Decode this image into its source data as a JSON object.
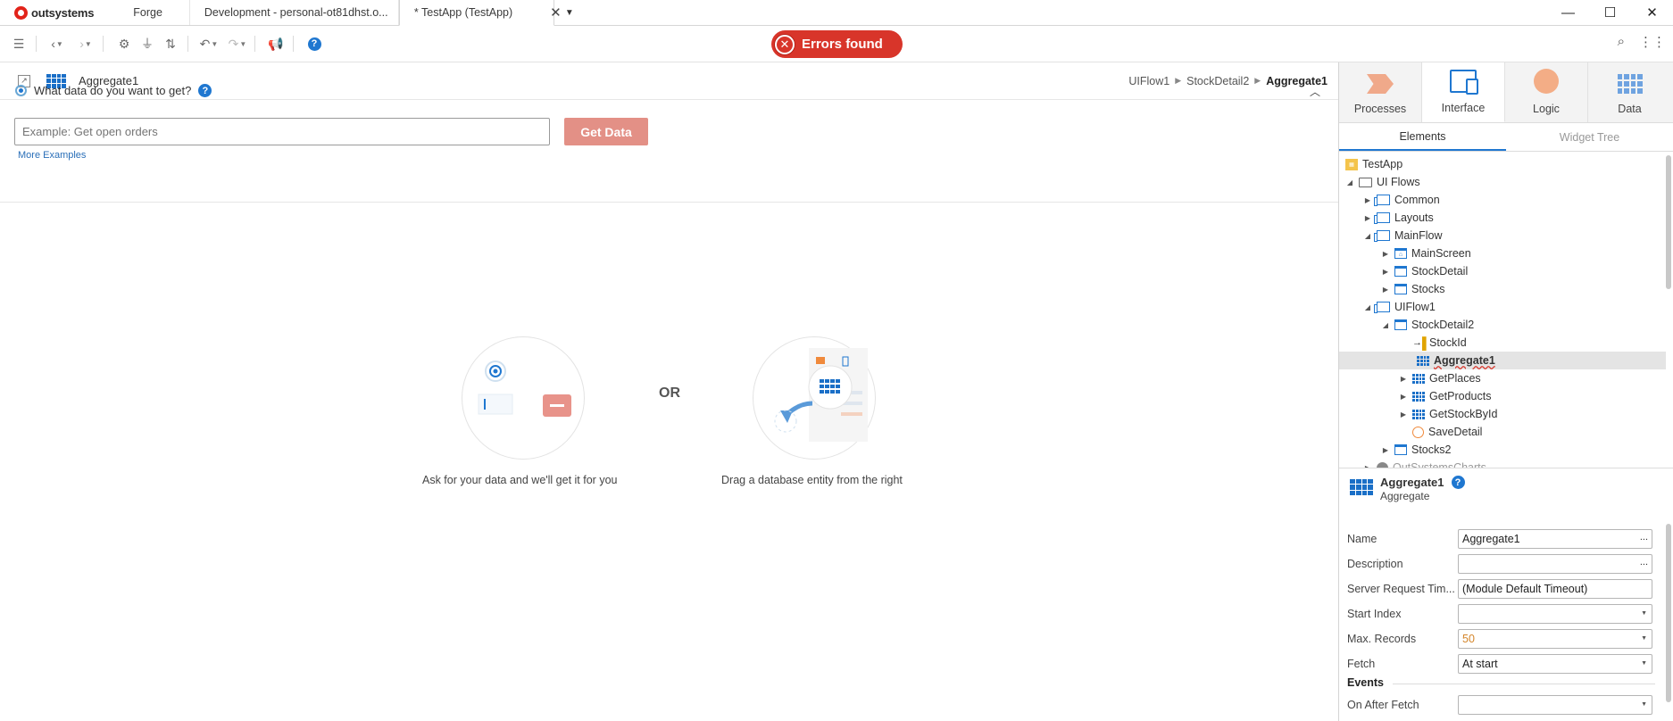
{
  "tabs": {
    "brand": "outsystems",
    "items": [
      {
        "label": "Forge"
      },
      {
        "label": "Development - personal-ot81dhst.o..."
      },
      {
        "label": "* TestApp (TestApp)",
        "close": "✕"
      }
    ],
    "menu": "▼"
  },
  "window": {
    "minimize": "—",
    "maximize": "☐",
    "close": "✕"
  },
  "toolbar": {
    "errors_label": "Errors found",
    "error_icon": "✕",
    "help": "?"
  },
  "editor": {
    "title": "Aggregate1",
    "breadcrumb": [
      "UIFlow1",
      "StockDetail2",
      "Aggregate1"
    ],
    "question": "What data do you want to get?",
    "input_placeholder": "Example: Get open orders",
    "get_data_label": "Get Data",
    "more_examples": "More Examples",
    "or_label": "OR",
    "caption_ask": "Ask for your data and we'll get it for you",
    "caption_drag": "Drag a database entity from the right"
  },
  "right_panel": {
    "tabs": [
      {
        "label": "Processes",
        "icon": "processes-icon"
      },
      {
        "label": "Interface",
        "icon": "interface-icon"
      },
      {
        "label": "Logic",
        "icon": "logic-icon"
      },
      {
        "label": "Data",
        "icon": "data-icon"
      }
    ],
    "subtabs": [
      "Elements",
      "Widget Tree"
    ],
    "tree": [
      {
        "label": "TestApp"
      },
      {
        "label": "UI Flows"
      },
      {
        "label": "Common"
      },
      {
        "label": "Layouts"
      },
      {
        "label": "MainFlow"
      },
      {
        "label": "MainScreen"
      },
      {
        "label": "StockDetail"
      },
      {
        "label": "Stocks"
      },
      {
        "label": "UIFlow1"
      },
      {
        "label": "StockDetail2"
      },
      {
        "label": "StockId"
      },
      {
        "label": "Aggregate1"
      },
      {
        "label": "GetPlaces"
      },
      {
        "label": "GetProducts"
      },
      {
        "label": "GetStockById"
      },
      {
        "label": "SaveDetail"
      },
      {
        "label": "Stocks2"
      },
      {
        "label": "OutSystemsCharts"
      }
    ],
    "properties": {
      "title": "Aggregate1",
      "subtitle": "Aggregate",
      "rows": [
        {
          "label": "Name",
          "value": "Aggregate1"
        },
        {
          "label": "Description",
          "value": ""
        },
        {
          "label": "Server Request Tim...",
          "value": "(Module Default Timeout)"
        },
        {
          "label": "Start Index",
          "value": ""
        },
        {
          "label": "Max. Records",
          "value": "50"
        },
        {
          "label": "Fetch",
          "value": "At start"
        }
      ],
      "events_label": "Events",
      "events": [
        {
          "label": "On After Fetch",
          "value": ""
        }
      ]
    }
  }
}
